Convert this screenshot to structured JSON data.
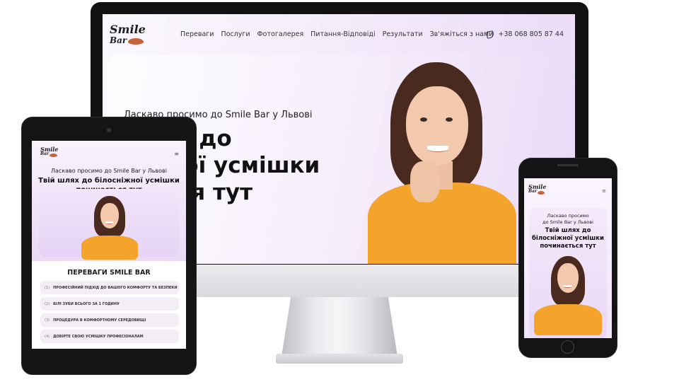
{
  "brand": {
    "logo_line1": "Smile",
    "logo_line2": "Bar"
  },
  "desktop": {
    "nav": [
      "Переваги",
      "Послуги",
      "Фотогалерея",
      "Питання-Відповіді",
      "Результати",
      "Зв'яжіться з нами"
    ],
    "phone": "+38 068 805 87 44",
    "welcome": "Ласкаво просимо до Smile Bar у Львові",
    "title_lines": [
      "шлях до",
      "ніжної усмішки",
      "ається тут"
    ]
  },
  "tablet": {
    "menu_icon": "≡",
    "welcome": "Ласкаво просимо до Smile Bar у Львові",
    "title_lines": [
      "Твій шлях до білосніжної усмішки",
      "починається тут"
    ],
    "section_title": "ПЕРЕВАГИ SMILE BAR",
    "advantages": [
      {
        "num": "(1)",
        "text": "ПРОФЕСІЙНИЙ ПІДХІД ДО ВАШОГО КОМФОРТУ ТА БЕЗПЕКИ"
      },
      {
        "num": "(2)",
        "text": "БІЛІ ЗУБИ ВСЬОГО ЗА 1 ГОДИНУ"
      },
      {
        "num": "(3)",
        "text": "ПРОЦЕДУРА В КОМФОРТНОМУ СЕРЕДОВИЩІ"
      },
      {
        "num": "(4)",
        "text": "ДОВІРТЕ СВОЮ УСМІШКУ ПРОФЕСІОНАЛАМ"
      }
    ]
  },
  "mobile": {
    "menu_icon": "≡",
    "welcome_lines": [
      "Ласкаво просимо",
      "до Smile Bar у Львові"
    ],
    "title_lines": [
      "Твій шлях до",
      "білосніжної усмішки",
      "починається тут"
    ]
  },
  "colors": {
    "accent": "#c8623b",
    "shirt": "#f4a42a",
    "hero_bg": "#ead9f7"
  }
}
